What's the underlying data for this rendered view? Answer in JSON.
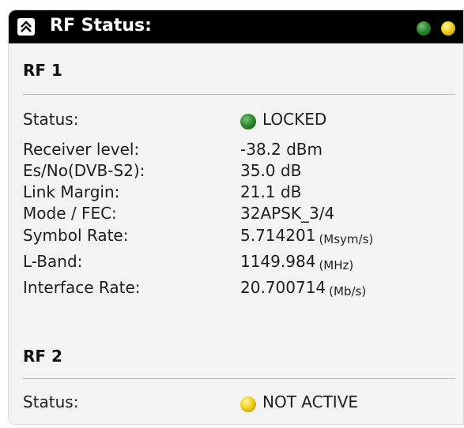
{
  "panel": {
    "title": "RF Status:",
    "collapse_icon": "double-chevron-up-icon",
    "indicator_colors": [
      "#2e8a2e",
      "#f1cf1a"
    ]
  },
  "rf1": {
    "title": "RF 1",
    "status": {
      "label": "Status:",
      "value": "LOCKED",
      "led_color": "#2e8a2e"
    },
    "receiver_level": {
      "label": "Receiver level:",
      "value": "-38.2 dBm"
    },
    "esno": {
      "label": "Es/No(DVB-S2):",
      "value": "35.0 dB"
    },
    "link_margin": {
      "label": "Link Margin:",
      "value": "21.1 dB"
    },
    "mode_fec": {
      "label": "Mode / FEC:",
      "value": "32APSK_3/4"
    },
    "symbol_rate": {
      "label": "Symbol Rate:",
      "value": "5.714201",
      "unit": "(Msym/s)"
    },
    "lband": {
      "label": "L-Band:",
      "value": "1149.984",
      "unit": "(MHz)"
    },
    "interface_rate": {
      "label": "Interface Rate:",
      "value": "20.700714",
      "unit": "(Mb/s)"
    }
  },
  "rf2": {
    "title": "RF 2",
    "status": {
      "label": "Status:",
      "value": "NOT ACTIVE",
      "led_color": "#f1cf1a"
    }
  }
}
